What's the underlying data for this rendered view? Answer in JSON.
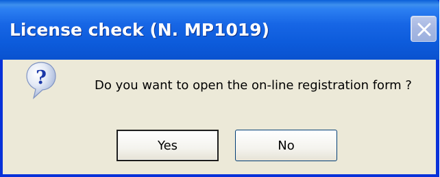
{
  "window": {
    "title": "License check (N. MP1019)",
    "close_icon": "close-icon"
  },
  "message": {
    "icon": "question-icon",
    "text": "Do you want to open the on-line registration form ?"
  },
  "buttons": {
    "yes_label": "Yes",
    "no_label": "No"
  },
  "colors": {
    "titlebar": "#0a5fd8",
    "frame": "#0831d9",
    "dialog_bg": "#ece9d8"
  }
}
